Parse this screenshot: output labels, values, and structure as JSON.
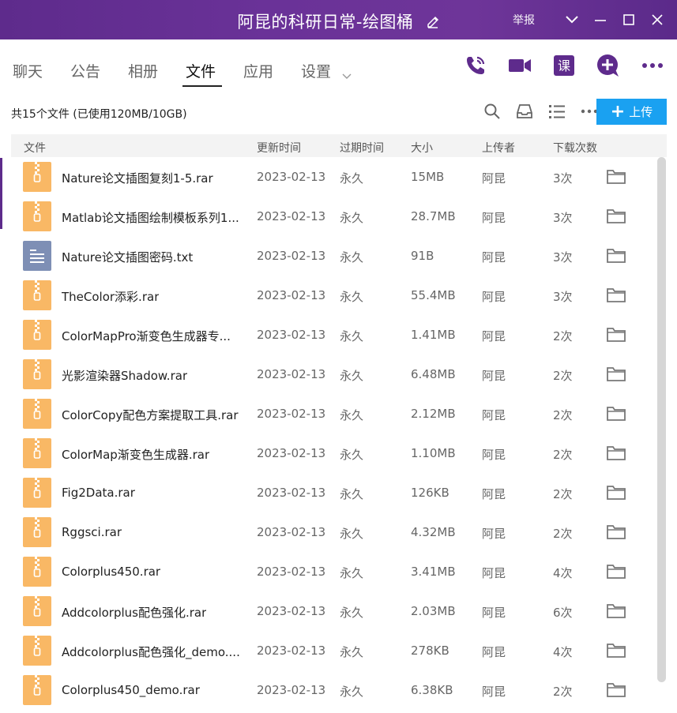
{
  "window": {
    "title": "阿昆的科研日常-绘图桶",
    "report_label": "举报",
    "icons": [
      "edit-icon",
      "chevron-down-icon",
      "minimize-icon",
      "maximize-icon",
      "close-icon"
    ]
  },
  "tabs": [
    {
      "label": "聊天"
    },
    {
      "label": "公告"
    },
    {
      "label": "相册"
    },
    {
      "label": "文件"
    },
    {
      "label": "应用"
    },
    {
      "label": "设置"
    }
  ],
  "active_tab": "文件",
  "tab_actions": {
    "lesson_label": "课",
    "icons": [
      "phone-icon",
      "video-icon",
      "lesson-icon",
      "add-icon",
      "more-icon"
    ]
  },
  "toolbar": {
    "file_count": "共15个文件 (已使用120MB/10GB)",
    "upload_label": "上传",
    "icons": [
      "search-icon",
      "inbox-icon",
      "list-view-icon",
      "more-icon"
    ]
  },
  "table": {
    "headers": {
      "name": "文件",
      "updated": "更新时间",
      "expire": "过期时间",
      "size": "大小",
      "uploader": "上传者",
      "downloads": "下载次数"
    },
    "rows": [
      {
        "name": "Nature论文插图复刻1-5.rar",
        "updated": "2023-02-13",
        "expire": "永久",
        "size": "15MB",
        "uploader": "阿昆",
        "downloads": "3次",
        "type": "zip"
      },
      {
        "name": "Matlab论文插图绘制模板系列1...",
        "updated": "2023-02-13",
        "expire": "永久",
        "size": "28.7MB",
        "uploader": "阿昆",
        "downloads": "3次",
        "type": "zip"
      },
      {
        "name": "Nature论文插图密码.txt",
        "updated": "2023-02-13",
        "expire": "永久",
        "size": "91B",
        "uploader": "阿昆",
        "downloads": "3次",
        "type": "txt"
      },
      {
        "name": "TheColor添彩.rar",
        "updated": "2023-02-13",
        "expire": "永久",
        "size": "55.4MB",
        "uploader": "阿昆",
        "downloads": "3次",
        "type": "zip"
      },
      {
        "name": "ColorMapPro渐变色生成器专...",
        "updated": "2023-02-13",
        "expire": "永久",
        "size": "1.41MB",
        "uploader": "阿昆",
        "downloads": "2次",
        "type": "zip"
      },
      {
        "name": "光影渲染器Shadow.rar",
        "updated": "2023-02-13",
        "expire": "永久",
        "size": "6.48MB",
        "uploader": "阿昆",
        "downloads": "2次",
        "type": "zip"
      },
      {
        "name": "ColorCopy配色方案提取工具.rar",
        "updated": "2023-02-13",
        "expire": "永久",
        "size": "2.12MB",
        "uploader": "阿昆",
        "downloads": "2次",
        "type": "zip"
      },
      {
        "name": "ColorMap渐变色生成器.rar",
        "updated": "2023-02-13",
        "expire": "永久",
        "size": "1.10MB",
        "uploader": "阿昆",
        "downloads": "2次",
        "type": "zip"
      },
      {
        "name": "Fig2Data.rar",
        "updated": "2023-02-13",
        "expire": "永久",
        "size": "126KB",
        "uploader": "阿昆",
        "downloads": "2次",
        "type": "zip"
      },
      {
        "name": "Rggsci.rar",
        "updated": "2023-02-13",
        "expire": "永久",
        "size": "4.32MB",
        "uploader": "阿昆",
        "downloads": "2次",
        "type": "zip"
      },
      {
        "name": "Colorplus450.rar",
        "updated": "2023-02-13",
        "expire": "永久",
        "size": "3.41MB",
        "uploader": "阿昆",
        "downloads": "4次",
        "type": "zip"
      },
      {
        "name": "Addcolorplus配色强化.rar",
        "updated": "2023-02-13",
        "expire": "永久",
        "size": "2.03MB",
        "uploader": "阿昆",
        "downloads": "6次",
        "type": "zip"
      },
      {
        "name": "Addcolorplus配色强化_demo....",
        "updated": "2023-02-13",
        "expire": "永久",
        "size": "278KB",
        "uploader": "阿昆",
        "downloads": "4次",
        "type": "zip"
      },
      {
        "name": "Colorplus450_demo.rar",
        "updated": "2023-02-13",
        "expire": "永久",
        "size": "6.38KB",
        "uploader": "阿昆",
        "downloads": "2次",
        "type": "zip"
      }
    ]
  },
  "colors": {
    "accent": "#6a3298",
    "upload": "#1aa1f1",
    "zip_icon": "#f9b865",
    "txt_icon": "#7e8fb5"
  }
}
